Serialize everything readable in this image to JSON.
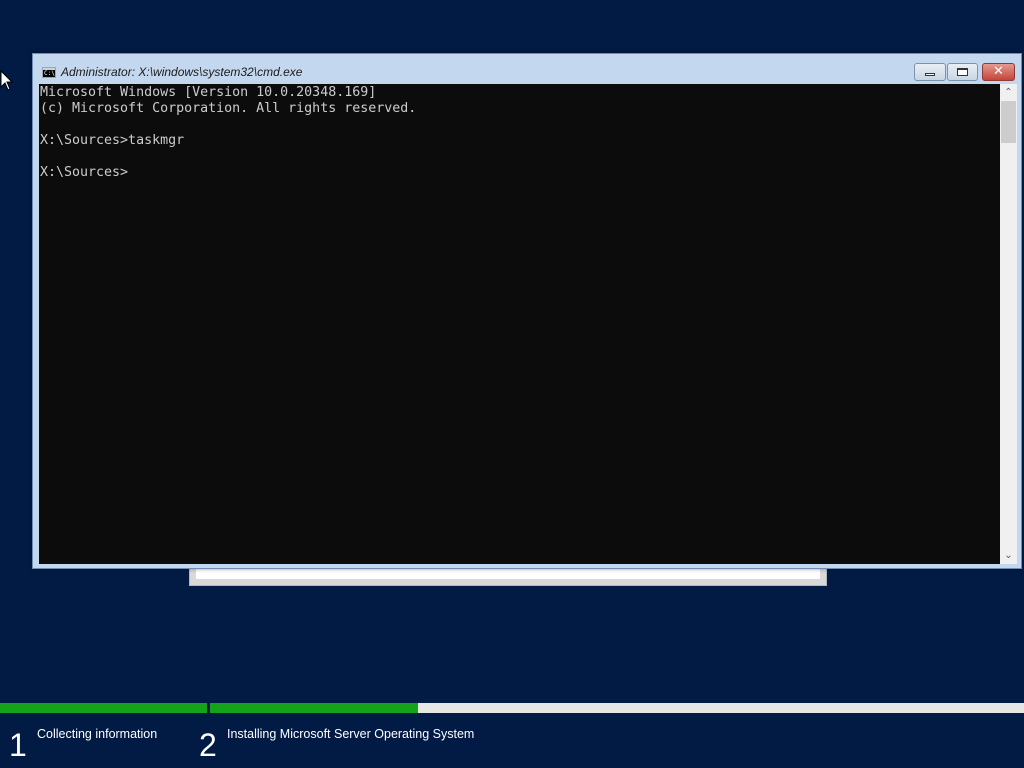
{
  "window": {
    "title": "Administrator: X:\\windows\\system32\\cmd.exe",
    "icon": "cmd-icon",
    "icon_text": "C:\\",
    "buttons": {
      "minimize": "minimize-icon",
      "maximize": "maximize-icon",
      "close": "close-icon",
      "close_glyph": "✕"
    }
  },
  "console": {
    "lines": "Microsoft Windows [Version 10.0.20348.169]\n(c) Microsoft Corporation. All rights reserved.\n\nX:\\Sources>taskmgr\n\nX:\\Sources>",
    "background": "#0c0c0c",
    "foreground": "#cccccc"
  },
  "scrollbar": {
    "up_glyph": "⌃",
    "down_glyph": "⌄"
  },
  "setup": {
    "steps": [
      {
        "number": "1",
        "label": "Collecting information",
        "progress": 1.0
      },
      {
        "number": "2",
        "label": "Installing Microsoft Server Operating System",
        "progress": 0.255
      }
    ],
    "progress_color": "#16a31c",
    "background": "#011b45"
  }
}
